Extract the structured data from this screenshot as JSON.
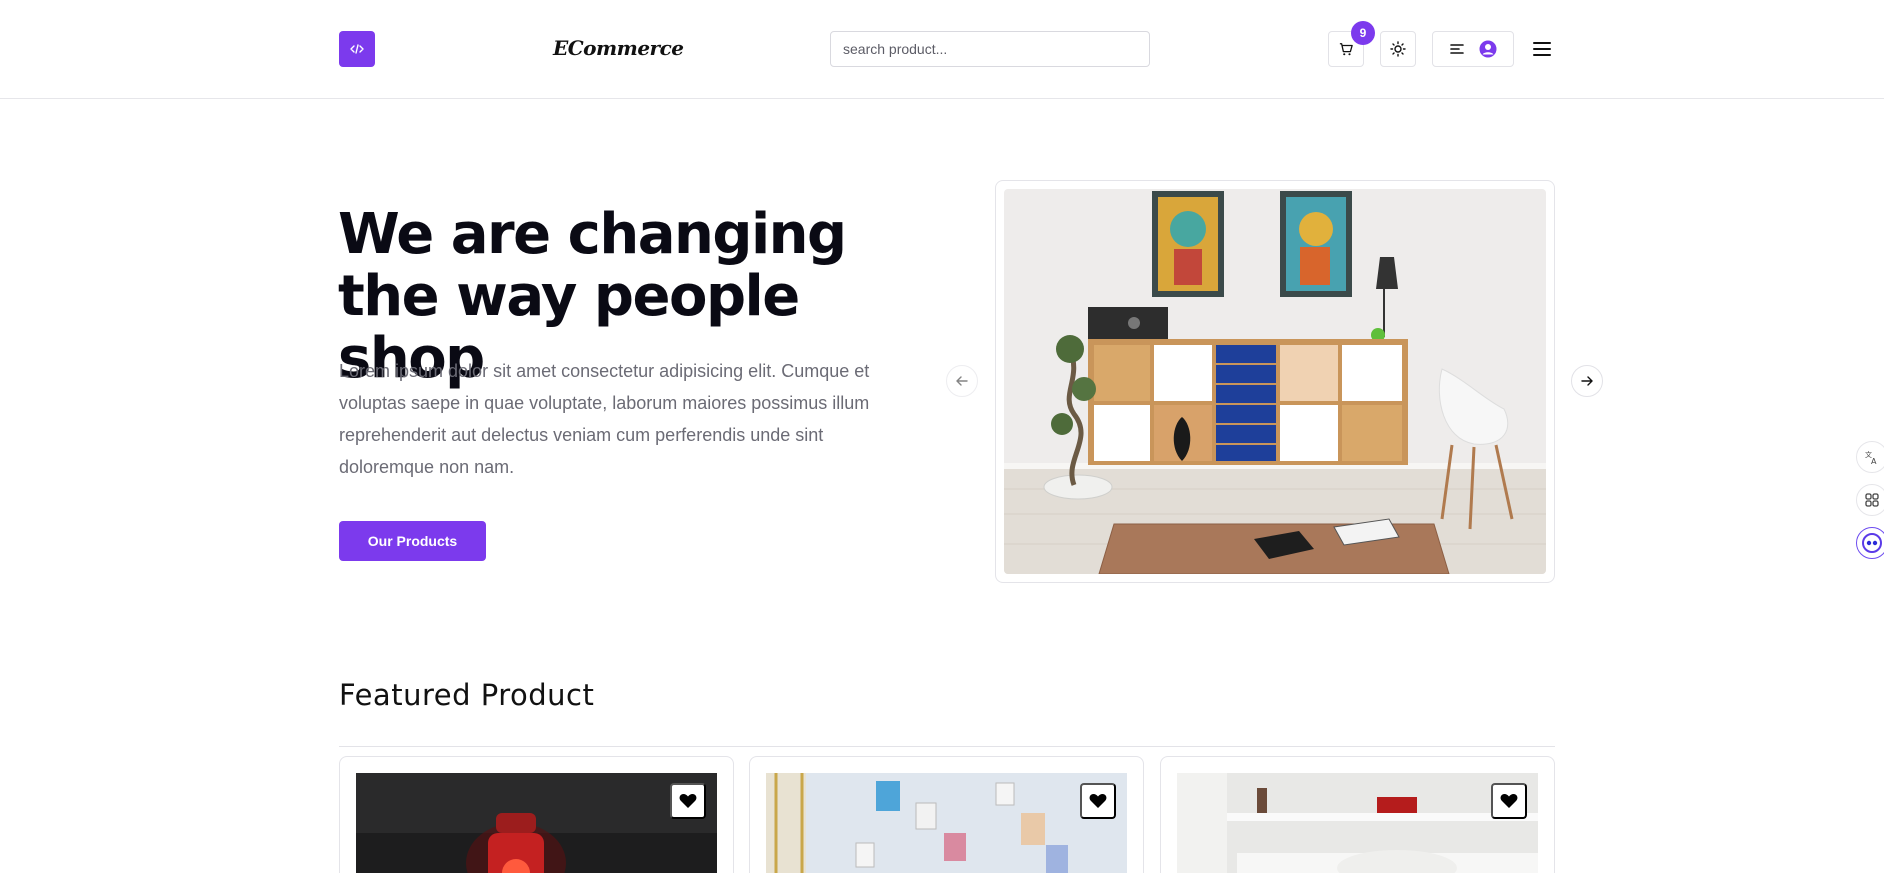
{
  "header": {
    "brand": "ECommerce",
    "search": {
      "placeholder": "search product...",
      "value": ""
    },
    "cart_count": "9",
    "icons": [
      "code-icon",
      "cart-icon",
      "sun-icon",
      "menu-lines-icon",
      "user-circle-icon",
      "hamburger-icon"
    ]
  },
  "hero": {
    "title": "We are changing the way people shop",
    "description": "Lorem ipsum dolor sit amet consectetur adipisicing elit. Cumque et voluptas saepe in quae voluptate, laborum maiores possimus illum reprehenderit aut delectus veniam cum perferendis unde sint doloremque non nam.",
    "cta_label": "Our Products"
  },
  "featured": {
    "title": "Featured Product",
    "products": [
      {
        "image": "red-lantern"
      },
      {
        "image": "moodboard-wall"
      },
      {
        "image": "white-bedroom"
      }
    ]
  },
  "side_tools": [
    "translate-icon",
    "apps-grid-icon",
    "assistant-icon"
  ],
  "colors": {
    "accent": "#7c3aed",
    "text": "#0a0a14",
    "muted": "#6b6b75",
    "border": "#e4e4e9"
  }
}
